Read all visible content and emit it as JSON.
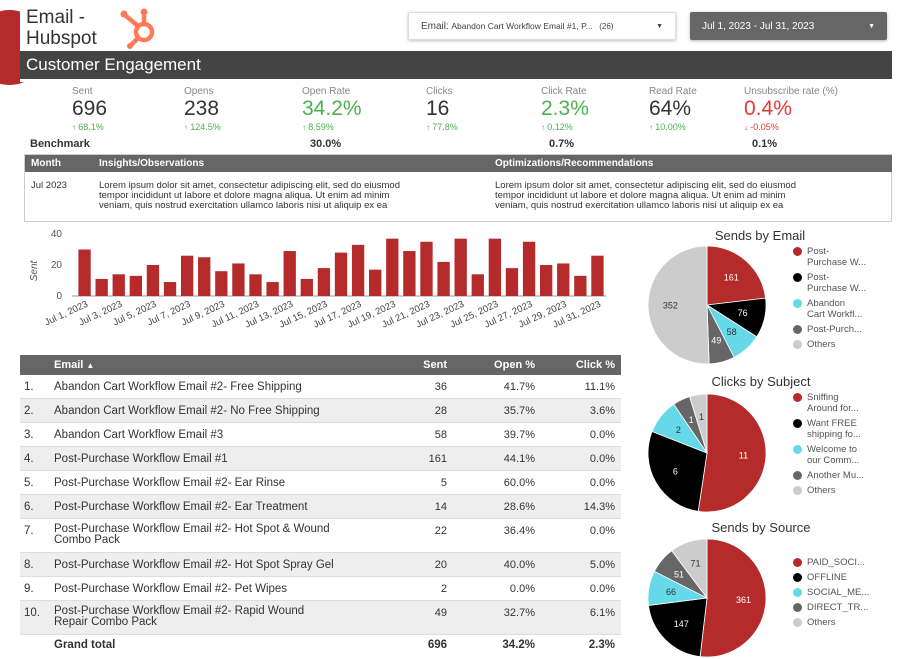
{
  "header": {
    "title_line1": "Email -",
    "title_line2": "Hubspot",
    "email_filter_label": "Email:",
    "email_filter_value": "Abandon Cart Workflow Email #1, P...",
    "email_filter_count": "(26)",
    "date_range": "Jul 1, 2023 - Jul 31, 2023",
    "section_title": "Customer Engagement",
    "colors": {
      "brand": "#b52a2a",
      "band": "#444444",
      "hubspot": "#ff7a59"
    }
  },
  "kpis": [
    {
      "label": "Sent",
      "value": "696",
      "delta": "68.1%",
      "dir": "up",
      "color": "normal"
    },
    {
      "label": "Opens",
      "value": "238",
      "delta": "124.5%",
      "dir": "up",
      "color": "normal"
    },
    {
      "label": "Open Rate",
      "value": "34.2%",
      "delta": "8.59%",
      "dir": "up",
      "color": "green",
      "benchmark": "30.0%"
    },
    {
      "label": "Clicks",
      "value": "16",
      "delta": "77.8%",
      "dir": "up",
      "color": "normal"
    },
    {
      "label": "Click Rate",
      "value": "2.3%",
      "delta": "0.12%",
      "dir": "up",
      "color": "green",
      "benchmark": "0.7%"
    },
    {
      "label": "Read Rate",
      "value": "64%",
      "delta": "10.00%",
      "dir": "up",
      "color": "normal"
    },
    {
      "label": "Unsubscribe rate (%)",
      "value": "0.4%",
      "delta": "-0.05%",
      "dir": "down",
      "color": "red",
      "benchmark": "0.1%"
    }
  ],
  "benchmark_label": "Benchmark",
  "insights": {
    "headers": [
      "Month",
      "Insights/Observations",
      "Optimizations/Recommendations"
    ],
    "month": "Jul 2023",
    "insight_lines": [
      "Lorem ipsum dolor sit amet, consectetur adipiscing elit, sed do eiusmod",
      "tempor incididunt ut labore et dolore magna aliqua. Ut enim ad minim",
      "veniam, quis nostrud exercitation ullamco laboris nisi ut aliquip ex ea"
    ],
    "rec_lines": [
      "Lorem ipsum dolor sit amet, consectetur adipiscing elit, sed do eiusmod",
      "tempor incididunt ut labore et dolore magna aliqua. Ut enim ad minim",
      "veniam, quis nostrud exercitation ullamco laboris nisi ut aliquip ex ea"
    ]
  },
  "chart_data": [
    {
      "type": "bar",
      "ylabel": "Sent",
      "ylim": [
        0,
        40
      ],
      "yticks": [
        0,
        20,
        40
      ],
      "color": "#b52a2a",
      "categories": [
        "Jul 1, 2023",
        "Jul 2, 2023",
        "Jul 3, 2023",
        "Jul 4, 2023",
        "Jul 5, 2023",
        "Jul 6, 2023",
        "Jul 7, 2023",
        "Jul 8, 2023",
        "Jul 9, 2023",
        "Jul 10, 2023",
        "Jul 11, 2023",
        "Jul 12, 2023",
        "Jul 13, 2023",
        "Jul 14, 2023",
        "Jul 15, 2023",
        "Jul 16, 2023",
        "Jul 17, 2023",
        "Jul 18, 2023",
        "Jul 19, 2023",
        "Jul 20, 2023",
        "Jul 21, 2023",
        "Jul 22, 2023",
        "Jul 23, 2023",
        "Jul 24, 2023",
        "Jul 25, 2023",
        "Jul 26, 2023",
        "Jul 27, 2023",
        "Jul 28, 2023",
        "Jul 29, 2023",
        "Jul 30, 2023",
        "Jul 31, 2023"
      ],
      "tick_labels": [
        "Jul 1, 2023",
        "Jul 3, 2023",
        "Jul 5, 2023",
        "Jul 7, 2023",
        "Jul 9, 2023",
        "Jul 11, 2023",
        "Jul 13, 2023",
        "Jul 15, 2023",
        "Jul 17, 2023",
        "Jul 19, 2023",
        "Jul 21, 2023",
        "Jul 23, 2023",
        "Jul 25, 2023",
        "Jul 27, 2023",
        "Jul 29, 2023",
        "Jul 31, 2023"
      ],
      "values": [
        30,
        11,
        14,
        13,
        20,
        9,
        26,
        25,
        16,
        21,
        14,
        9,
        29,
        11,
        18,
        28,
        33,
        17,
        37,
        29,
        35,
        22,
        37,
        14,
        37,
        18,
        35,
        20,
        21,
        13,
        26
      ]
    },
    {
      "type": "pie",
      "title": "Sends by Email",
      "slices": [
        {
          "label": "Post-Purchase W...",
          "value": 161,
          "color": "#b52a2a"
        },
        {
          "label": "Post-Purchase W...",
          "value": 76,
          "color": "#000000"
        },
        {
          "label": "Abandon Cart Workfl...",
          "value": 58,
          "color": "#66d9e8"
        },
        {
          "label": "Post-Purch...",
          "value": 49,
          "color": "#666666"
        },
        {
          "label": "Others",
          "value": 352,
          "color": "#cccccc"
        }
      ]
    },
    {
      "type": "pie",
      "title": "Clicks by Subject",
      "slices": [
        {
          "label": "Sniffing Around for...",
          "value": 11,
          "color": "#b52a2a"
        },
        {
          "label": "Want FREE shipping fo...",
          "value": 6,
          "color": "#000000"
        },
        {
          "label": "Welcome to our Comm...",
          "value": 2,
          "color": "#66d9e8"
        },
        {
          "label": "Another Mu...",
          "value": 1,
          "color": "#666666"
        },
        {
          "label": "Others",
          "value": 1,
          "color": "#cccccc"
        }
      ]
    },
    {
      "type": "pie",
      "title": "Sends by Source",
      "slices": [
        {
          "label": "PAID_SOCI...",
          "value": 361,
          "color": "#b52a2a"
        },
        {
          "label": "OFFLINE",
          "value": 147,
          "color": "#000000"
        },
        {
          "label": "SOCIAL_ME...",
          "value": 66,
          "color": "#66d9e8"
        },
        {
          "label": "DIRECT_TR...",
          "value": 51,
          "color": "#666666"
        },
        {
          "label": "Others",
          "value": 71,
          "color": "#cccccc"
        }
      ]
    }
  ],
  "legends": {
    "sends_email": [
      [
        "Post-",
        "Purchase W..."
      ],
      [
        "Post-",
        "Purchase W..."
      ],
      [
        "Abandon",
        "Cart Workfl..."
      ],
      [
        "Post-Purch..."
      ],
      [
        "Others"
      ]
    ],
    "clicks_subject": [
      [
        "Sniffing",
        "Around for..."
      ],
      [
        "Want FREE",
        "shipping fo..."
      ],
      [
        "Welcome to",
        "our Comm..."
      ],
      [
        "Another Mu..."
      ],
      [
        "Others"
      ]
    ],
    "sends_source": [
      [
        "PAID_SOCI..."
      ],
      [
        "OFFLINE"
      ],
      [
        "SOCIAL_ME..."
      ],
      [
        "DIRECT_TR..."
      ],
      [
        "Others"
      ]
    ]
  },
  "table": {
    "headers": [
      "Email",
      "Sent",
      "Open %",
      "Click %"
    ],
    "sort_indicator": "▲",
    "rows": [
      {
        "n": "1.",
        "email": "Abandon Cart Workflow Email #2- Free Shipping",
        "sent": "36",
        "open": "41.7%",
        "click": "11.1%"
      },
      {
        "n": "2.",
        "email": "Abandon Cart Workflow Email #2- No Free Shipping",
        "sent": "28",
        "open": "35.7%",
        "click": "3.6%"
      },
      {
        "n": "3.",
        "email": "Abandon Cart Workflow Email #3",
        "sent": "58",
        "open": "39.7%",
        "click": "0.0%"
      },
      {
        "n": "4.",
        "email": "Post-Purchase Workflow Email #1",
        "sent": "161",
        "open": "44.1%",
        "click": "0.0%"
      },
      {
        "n": "5.",
        "email": "Post-Purchase Workflow Email #2- Ear Rinse",
        "sent": "5",
        "open": "60.0%",
        "click": "0.0%"
      },
      {
        "n": "6.",
        "email": "Post-Purchase Workflow Email #2- Ear Treatment",
        "sent": "14",
        "open": "28.6%",
        "click": "14.3%"
      },
      {
        "n": "7.",
        "email": "Post-Purchase Workflow Email #2- Hot Spot & Wound",
        "email2": "Combo Pack",
        "sent": "22",
        "open": "36.4%",
        "click": "0.0%"
      },
      {
        "n": "8.",
        "email": "Post-Purchase Workflow Email #2- Hot Spot Spray Gel",
        "sent": "20",
        "open": "40.0%",
        "click": "5.0%"
      },
      {
        "n": "9.",
        "email": "Post-Purchase Workflow Email #2- Pet Wipes",
        "sent": "2",
        "open": "0.0%",
        "click": "0.0%"
      },
      {
        "n": "10.",
        "email": "Post-Purchase Workflow Email #2- Rapid Wound",
        "email2": "Repair Combo Pack",
        "sent": "49",
        "open": "32.7%",
        "click": "6.1%"
      }
    ],
    "total": {
      "label": "Grand total",
      "sent": "696",
      "open": "34.2%",
      "click": "2.3%"
    }
  }
}
